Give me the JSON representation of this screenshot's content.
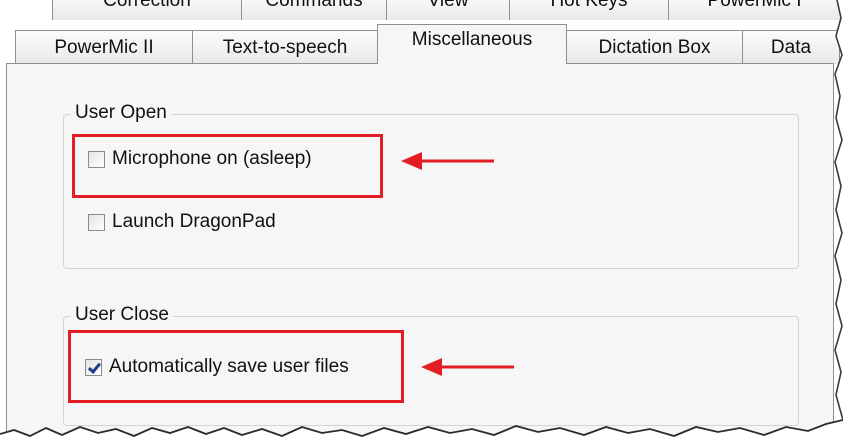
{
  "tabs": {
    "back_row": [
      "Correction",
      "Commands",
      "View",
      "Hot Keys",
      "PowerMic I"
    ],
    "front_row": [
      "PowerMic II",
      "Text-to-speech",
      "Miscellaneous",
      "Dictation Box",
      "Data"
    ],
    "active": "Miscellaneous"
  },
  "groups": {
    "user_open": {
      "legend": "User Open",
      "options": [
        {
          "label": "Microphone on (asleep)",
          "checked": false
        },
        {
          "label": "Launch DragonPad",
          "checked": false
        }
      ]
    },
    "user_close": {
      "legend": "User Close",
      "options": [
        {
          "label": "Automatically save user files",
          "checked": true
        }
      ]
    }
  },
  "colors": {
    "callout": "#e31d24",
    "panel_background": "#f6f6f6",
    "tab_border": "#8f8f8f"
  },
  "icons": [
    "arrow-left-icon",
    "checkmark-icon"
  ]
}
